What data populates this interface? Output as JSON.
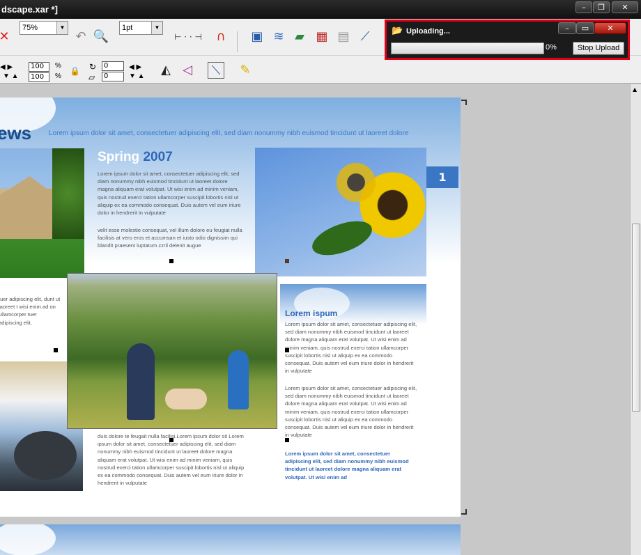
{
  "window": {
    "title": "dscape.xar *]",
    "buttons": {
      "minimize": "–",
      "restore": "❐",
      "close": "✕"
    }
  },
  "toolbar": {
    "zoom_value": "75%",
    "line_width": "1pt",
    "width_pct": "100",
    "height_pct": "100",
    "rotation": "0",
    "skew": "0"
  },
  "upload_dialog": {
    "title": "Uploading...",
    "percent": "0%",
    "progress": 0,
    "stop_label": "Stop Upload"
  },
  "document": {
    "headline": "ews",
    "tagline": "Lorem ipsum dolor sit amet, consectetuer adipiscing elit, sed diam nonummy nibh euismod tincidunt ut laoreet dolore",
    "spring_word": "Spring",
    "spring_year": "2007",
    "page_number": "1",
    "spring_para1": "Lorem ipsum dolor sit amet, consectetuer adipiscing elit, sed diam nonummy nibh euismod tincidunt ut laoreet dolore magna aliquam erat volutpat. Ut wisi enim ad minim veniam, quis nostrud exerci tation ullamcorper suscipit lobortis nisl ut aliquip ex ea commodo consequat. Duis autem vel eum iriure dolor in hendrerit in vulputate",
    "spring_para2": "velit esse molestie consequat, vel illum dolore eu feugiat nulla facilisis at vero eros et accumsan et iusto odio dignissim qui blandit praesent luptatum zzril delenit augue",
    "left_para": "tuer adipiscing elit, dunt ut laoreet t wisi enim ad on ullamcorper tuer adipiscing elit,",
    "bottom_para": "duis dolore te feugait nulla facilisi.Lorem ipsum dolor sit Lorem ipsum dolor sit amet, consectetuer adipiscing elit, sed diam nonummy nibh euismod tincidunt ut laoreet dolore magna aliquam erat volutpat. Ut wisi enim ad minim veniam, quis nostrud exerci tation ullamcorper suscipit lobortis nisl ut aliquip ex ea commodo consequat. Duis autem vel eum iriure dolor in hendrerit in vulputate",
    "lorem_heading": "Lorem ispum",
    "right_para1": "Lorem ipsum dolor sit amet, consectetuer adipiscing elit, sed diam nonummy nibh euismod tincidunt ut laoreet dolore magna aliquam erat volutpat. Ut wisi enim ad minim veniam, quis nostrud exerci tation ullamcorper suscipit lobortis nisl ut aliquip ex ea commodo consequat. Duis autem vel eum iriure dolor in hendrerit in vulputate",
    "right_para2": "Lorem ipsum dolor sit amet, consectetuer adipiscing elit, sed diam nonummy nibh euismod tincidunt ut laoreet dolore magna aliquam erat volutpat. Ut wisi enim ad minim veniam, quis nostrud exerci tation ullamcorper suscipit lobortis nisl ut aliquip ex ea commodo consequat. Duis autem vel eum iriure dolor in hendrerit in vulputate",
    "right_para3": "Lorem ipsum dolor sit amet, consectetuer adipiscing elit, sed diam nonummy nibh euismod tincidunt ut laoreet dolore magna aliquam erat volutpat. Ut wisi enim ad"
  }
}
